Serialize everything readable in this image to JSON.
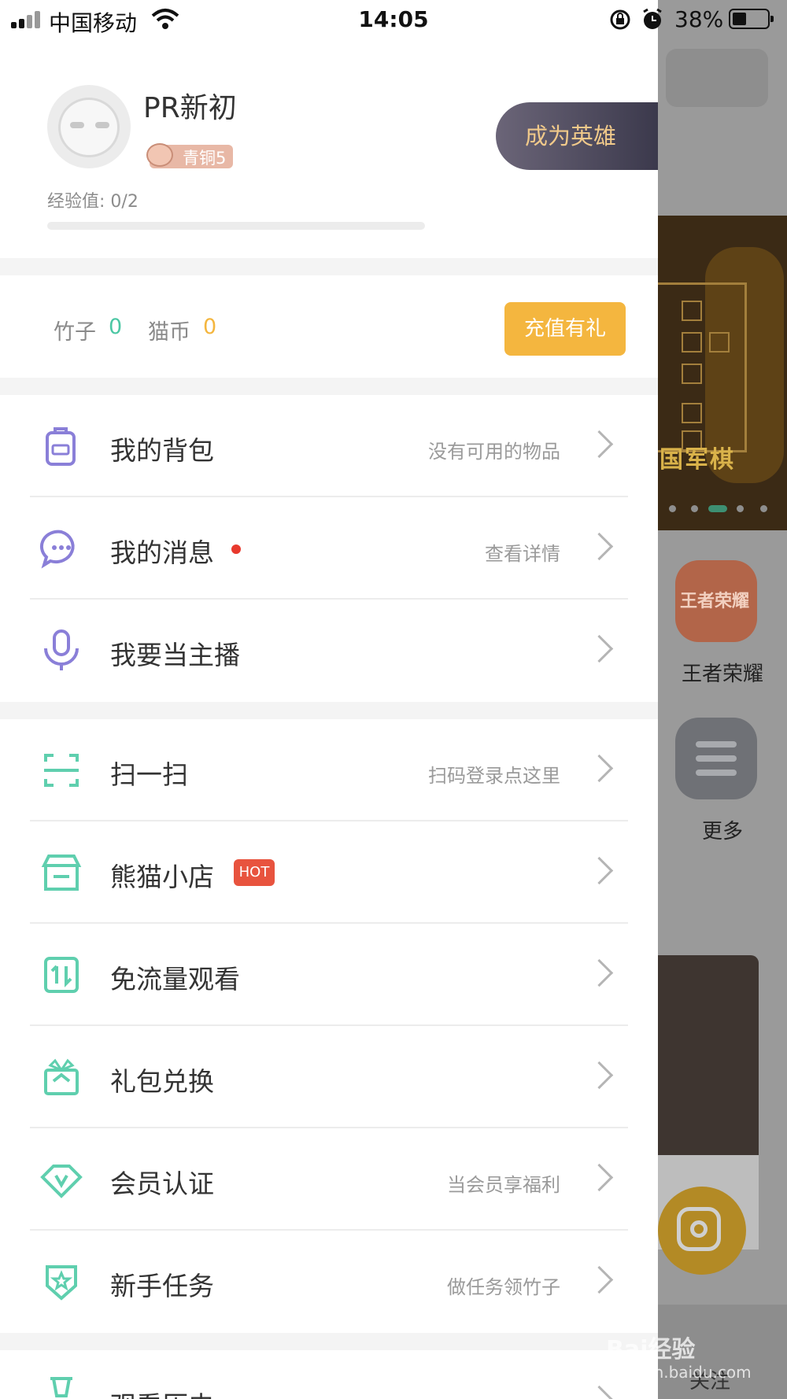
{
  "status_bar": {
    "carrier": "中国移动",
    "time": "14:05",
    "battery": "38%",
    "battery_level": 0.38
  },
  "profile": {
    "username": "PR新初",
    "level": "青铜5",
    "exp_label": "经验值: 0/2",
    "exp_progress": 0,
    "hero_button": "成为英雄"
  },
  "wallet": {
    "bamboo_label": "竹子",
    "bamboo_value": "0",
    "coin_label": "猫币",
    "coin_value": "0",
    "recharge_button": "充值有礼"
  },
  "menu_group1": [
    {
      "icon": "backpack-icon",
      "label": "我的背包",
      "sub": "没有可用的物品"
    },
    {
      "icon": "message-icon",
      "label": "我的消息",
      "sub": "查看详情",
      "badge": "dot"
    },
    {
      "icon": "microphone-icon",
      "label": "我要当主播",
      "sub": ""
    }
  ],
  "menu_group2": [
    {
      "icon": "scan-icon",
      "label": "扫一扫",
      "sub": "扫码登录点这里"
    },
    {
      "icon": "store-icon",
      "label": "熊猫小店",
      "sub": "",
      "badge": "HOT"
    },
    {
      "icon": "data-free-icon",
      "label": "免流量观看",
      "sub": ""
    },
    {
      "icon": "gift-icon",
      "label": "礼包兑换",
      "sub": ""
    },
    {
      "icon": "vip-diamond-icon",
      "label": "会员认证",
      "sub": "当会员享福利"
    },
    {
      "icon": "task-shield-icon",
      "label": "新手任务",
      "sub": "做任务领竹子"
    }
  ],
  "menu_group3": [
    {
      "icon": "history-icon",
      "label": "观看历史",
      "sub": ""
    }
  ],
  "background_app": {
    "app1_label": "王者荣耀",
    "app1_icon_text": "王者荣耀",
    "app2_label": "更多",
    "tab_label": "关注",
    "banner_text": "国军棋"
  },
  "watermark": {
    "brand": "Bai经验",
    "url": "jingyan.baidu.com"
  },
  "colors": {
    "accent_green": "#4cc7a4",
    "accent_yellow": "#f4b63f",
    "icon_purple": "#8a7fd8",
    "icon_green": "#5fcfae",
    "hot_red": "#e8533e"
  }
}
